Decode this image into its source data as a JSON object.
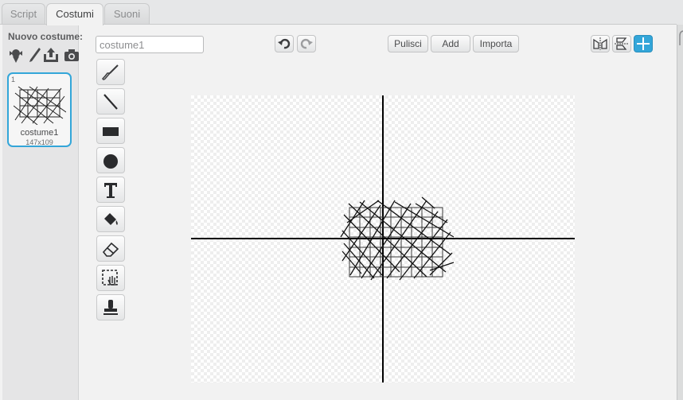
{
  "tabs": [
    {
      "label": "Script",
      "active": false
    },
    {
      "label": "Costumi",
      "active": true
    },
    {
      "label": "Suoni",
      "active": false
    }
  ],
  "sidebar": {
    "title": "Nuovo costume:",
    "icons": [
      "library-icon",
      "paint-icon",
      "upload-icon",
      "camera-icon"
    ]
  },
  "costumes": [
    {
      "number": "1",
      "name": "costume1",
      "size": "147x109",
      "selected": true
    }
  ],
  "editor": {
    "costume_name": "costume1",
    "undo_icon": "undo-icon",
    "redo_icon": "redo-icon",
    "buttons": {
      "clear": "Pulisci",
      "add": "Add",
      "import": "Importa"
    },
    "tools": [
      "brush",
      "line",
      "rectangle",
      "ellipse",
      "text",
      "fill",
      "eraser",
      "select",
      "stamp"
    ],
    "right_icons": [
      "flip-horizontal-icon",
      "flip-vertical-icon",
      "set-center-icon"
    ]
  },
  "colors": {
    "accent": "#33a6d9"
  }
}
